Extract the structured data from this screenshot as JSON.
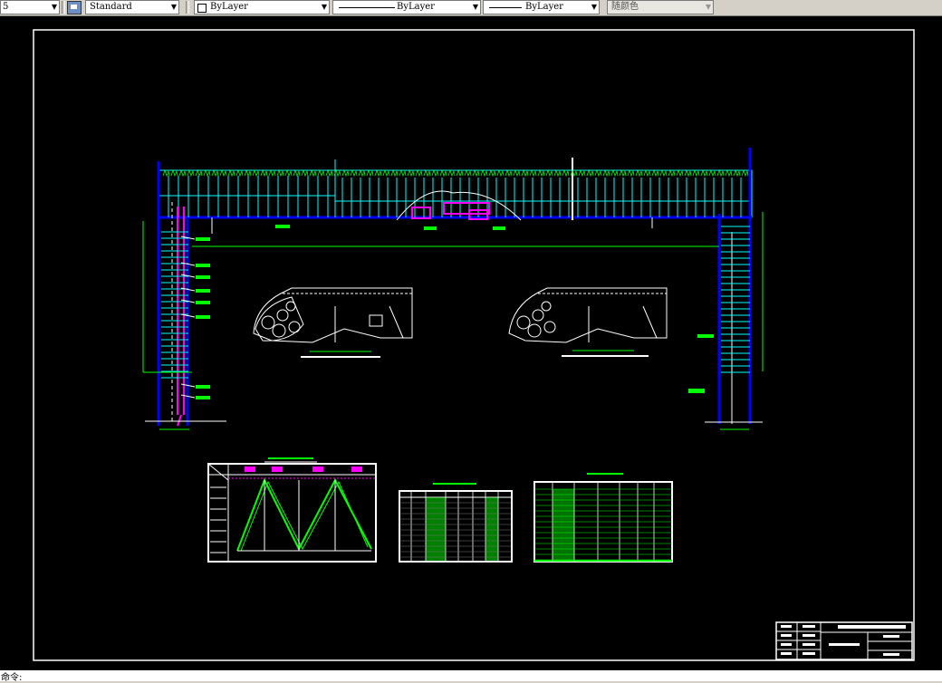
{
  "toolbar": {
    "layer_value": "5",
    "text_style": "Standard",
    "color": "ByLayer",
    "linetype": "ByLayer",
    "lineweight": "ByLayer",
    "plot_style": "随颜色"
  },
  "command_line": {
    "prompt": "命令:"
  },
  "colors": {
    "background": "#000000",
    "frame": "#ffffff",
    "steel": "#00ffff",
    "wall": "#0000ff",
    "highlight": "#ff00ff",
    "label": "#00ff00"
  }
}
